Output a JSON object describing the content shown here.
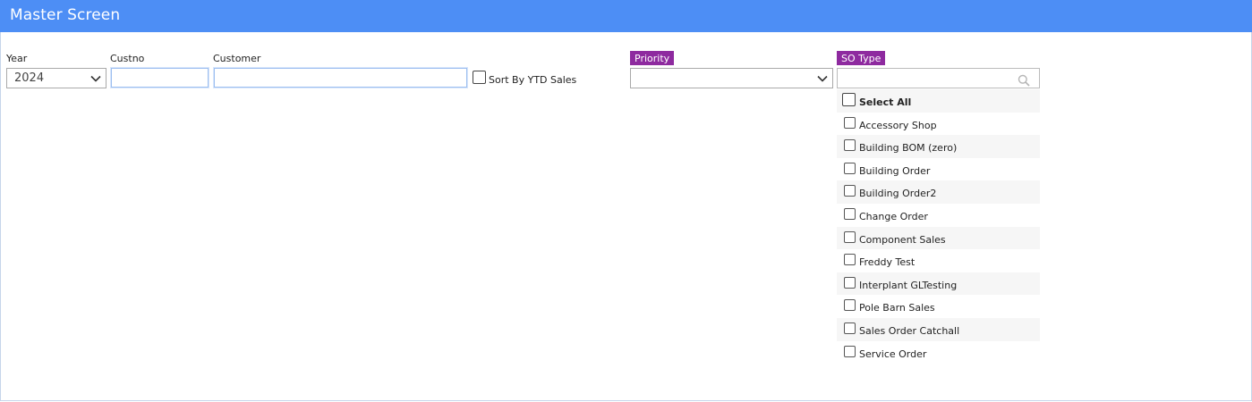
{
  "window": {
    "title": "Master Screen"
  },
  "filters": {
    "year_label": "Year",
    "year_value": "2024",
    "custno_label": "Custno",
    "custno_value": "",
    "customer_label": "Customer",
    "customer_value": "",
    "sort_label": "Sort By YTD Sales",
    "priority_label": "Priority",
    "priority_value": "",
    "so_type_label": "SO Type",
    "so_type_search_value": ""
  },
  "so_types": {
    "select_all": "Select All",
    "items": [
      "Accessory Shop",
      "Building BOM (zero)",
      "Building Order",
      "Building Order2",
      "Change Order",
      "Component Sales",
      "Freddy Test",
      "Interplant GLTesting",
      "Pole Barn Sales",
      "Sales Order Catchall",
      "Service Order"
    ]
  },
  "colors": {
    "title_bar": "#4d8ef5",
    "tag_purple": "#8e2a9f"
  }
}
